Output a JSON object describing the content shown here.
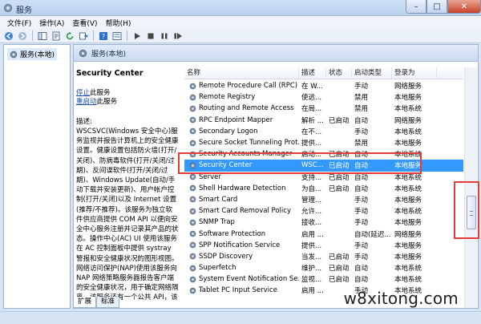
{
  "window": {
    "title": "服务",
    "min_glyph": "–",
    "max_glyph": "□",
    "close_glyph": "✕"
  },
  "menu": [
    "文件(F)",
    "操作(A)",
    "查看(V)",
    "帮助(H)"
  ],
  "tree": {
    "item": "服务(本地)"
  },
  "main": {
    "header": "服务(本地)"
  },
  "detail": {
    "title": "Security Center",
    "stop_link": "停止",
    "stop_suffix": "此服务",
    "restart_link": "重启动",
    "restart_suffix": "此服务",
    "desc_label": "描述:",
    "desc": "WSCSVC(Windows 安全中心)服务监视并报告计算机上的安全健康设置。健康设置包括防火墙(打开/关闭)、防病毒软件(打开/关闭/过期)、反间谍软件(打开/关闭/过期)、Windows Update(自动/手动下载并安装更新)、用户帐户控制(打开/关闭)以及 Internet 设置(推荐/不推荐)。该服务为独立软件供应商提供 COM API 以便向安全中心服务注册并记录其产品的状态。操作中心(AC) UI 使用该服务在 AC 控制面板中提供 systray 警报和安全健康状况的图形视图。网络访问保护(NAP)使用该服务向 NAP 网络策略服务器报告客户端的安全健康状况，用于确定网络隔离。该服务还有一个公共 API，该 API"
  },
  "columns": [
    "名称",
    "描述",
    "状态",
    "启动类型",
    "登录为"
  ],
  "services": [
    {
      "name": "Remote Procedure Call (RPC) ...",
      "desc": "在 W...",
      "status": "",
      "startup": "手动",
      "logon": "网络服务"
    },
    {
      "name": "Remote Registry",
      "desc": "使远...",
      "status": "",
      "startup": "禁用",
      "logon": "本地服务"
    },
    {
      "name": "Routing and Remote Access",
      "desc": "在局...",
      "status": "",
      "startup": "禁用",
      "logon": "本地系统"
    },
    {
      "name": "RPC Endpoint Mapper",
      "desc": "解析 ...",
      "status": "已启动",
      "startup": "自动",
      "logon": "网络服务"
    },
    {
      "name": "Secondary Logon",
      "desc": "在不...",
      "status": "",
      "startup": "手动",
      "logon": "本地系统"
    },
    {
      "name": "Secure Socket Tunneling Prot...",
      "desc": "提供...",
      "status": "",
      "startup": "禁用",
      "logon": "本地服务"
    },
    {
      "name": "Security Accounts Manager",
      "desc": "启动...",
      "status": "已启动",
      "startup": "自动",
      "logon": "本地系统"
    },
    {
      "name": "Security Center",
      "desc": "WSC...",
      "status": "已启动",
      "startup": "自动",
      "logon": "本地服务",
      "selected": true
    },
    {
      "name": "Server",
      "desc": "支持...",
      "status": "已启动",
      "startup": "自动",
      "logon": "本地系统"
    },
    {
      "name": "Shell Hardware Detection",
      "desc": "为自...",
      "status": "已启动",
      "startup": "自动",
      "logon": "本地系统"
    },
    {
      "name": "Smart Card",
      "desc": "管理...",
      "status": "",
      "startup": "手动",
      "logon": "本地服务"
    },
    {
      "name": "Smart Card Removal Policy",
      "desc": "允许...",
      "status": "",
      "startup": "手动",
      "logon": "本地系统"
    },
    {
      "name": "SNMP Trap",
      "desc": "接收...",
      "status": "",
      "startup": "手动",
      "logon": "本地服务"
    },
    {
      "name": "Software Protection",
      "desc": "启用 ...",
      "status": "",
      "startup": "自动(延迟...",
      "logon": "网络服务"
    },
    {
      "name": "SPP Notification Service",
      "desc": "提供...",
      "status": "",
      "startup": "手动",
      "logon": "本地服务"
    },
    {
      "name": "SSDP Discovery",
      "desc": "当发...",
      "status": "已启动",
      "startup": "手动",
      "logon": "本地服务"
    },
    {
      "name": "Superfetch",
      "desc": "维护...",
      "status": "已启动",
      "startup": "自动",
      "logon": "本地系统"
    },
    {
      "name": "System Event Notification Se...",
      "desc": "监视...",
      "status": "已启动",
      "startup": "自动",
      "logon": "本地系统"
    },
    {
      "name": "Tablet PC Input Service",
      "desc": "启用 ...",
      "status": "",
      "startup": "手动",
      "logon": "本地系统"
    }
  ],
  "tabs": [
    "扩展",
    "标准"
  ],
  "watermark": "w8xitong.com",
  "colors": {
    "selection": "#3399ff",
    "highlight_box": "#e53b3b",
    "link": "#1c4fb0"
  },
  "icons": [
    "services-app-icon",
    "back-arrow-icon",
    "forward-arrow-icon",
    "console-tree-icon",
    "properties-icon",
    "refresh-icon",
    "export-icon",
    "help-icon",
    "view-icon",
    "start-icon",
    "stop-icon",
    "pause-icon",
    "restart-icon",
    "gear-icon"
  ]
}
